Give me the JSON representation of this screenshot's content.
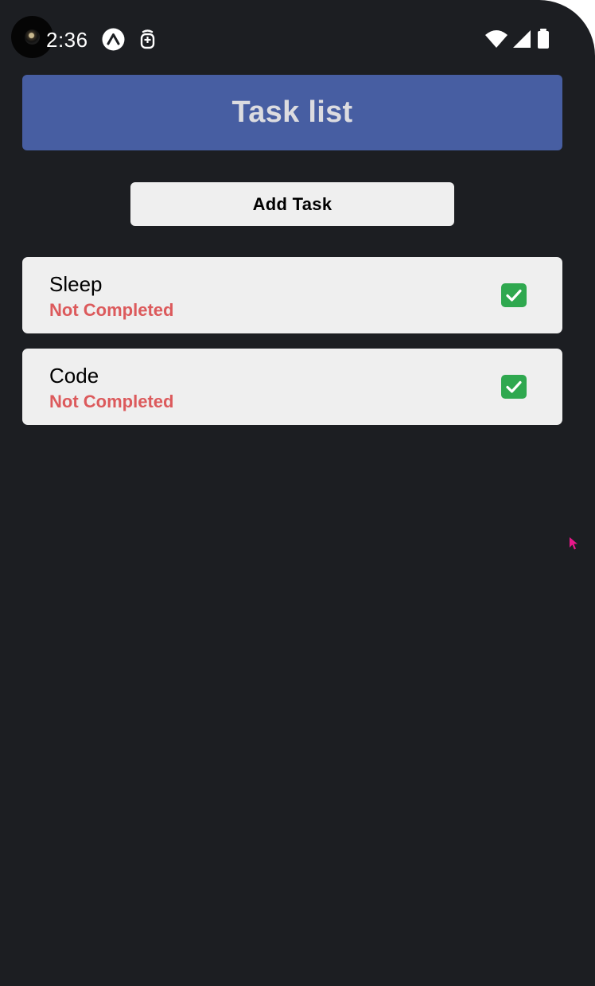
{
  "status_bar": {
    "time": "2:36",
    "icons": [
      "expo-icon",
      "app-notification-icon",
      "wifi-icon",
      "signal-icon",
      "battery-icon"
    ]
  },
  "header": {
    "title": "Task list",
    "color": "#475ea2"
  },
  "toolbar": {
    "add_label": "Add Task"
  },
  "tasks": [
    {
      "name": "Sleep",
      "status": "Not Completed",
      "action_icon": "check-mark-button-icon"
    },
    {
      "name": "Code",
      "status": "Not Completed",
      "action_icon": "check-mark-button-icon"
    }
  ],
  "colors": {
    "background": "#1c1e22",
    "card": "#efefef",
    "status_not_completed": "#dc5a5c",
    "check": "#2fa84f"
  }
}
